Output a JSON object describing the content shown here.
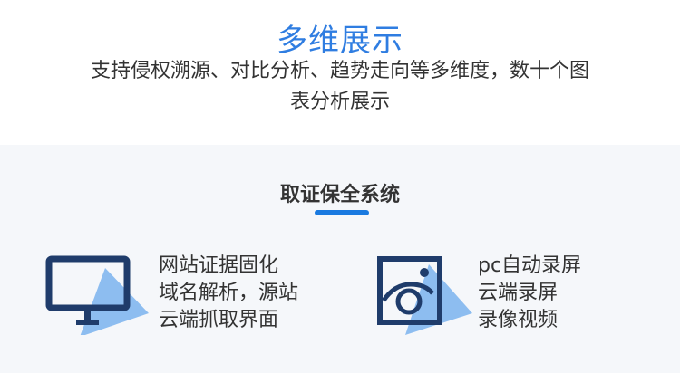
{
  "header": {
    "title": "多维展示",
    "description": "支持侵权溯源、对比分析、趋势走向等多维度，数十个图表分析展示"
  },
  "section": {
    "title": "取证保全系统"
  },
  "features": [
    {
      "icon": "monitor-icon",
      "lines": [
        "网站证据固化",
        "域名解析，源站",
        "云端抓取界面"
      ]
    },
    {
      "icon": "camera-screen-icon",
      "lines": [
        "pc自动录屏",
        "云端录屏",
        "录像视频"
      ]
    }
  ],
  "colors": {
    "accent": "#2f7de1",
    "underline": "#1a7ae0",
    "icon_dark": "#1f3c6b",
    "icon_light": "#8dbdf0",
    "section_bg": "#f5f7fa"
  }
}
